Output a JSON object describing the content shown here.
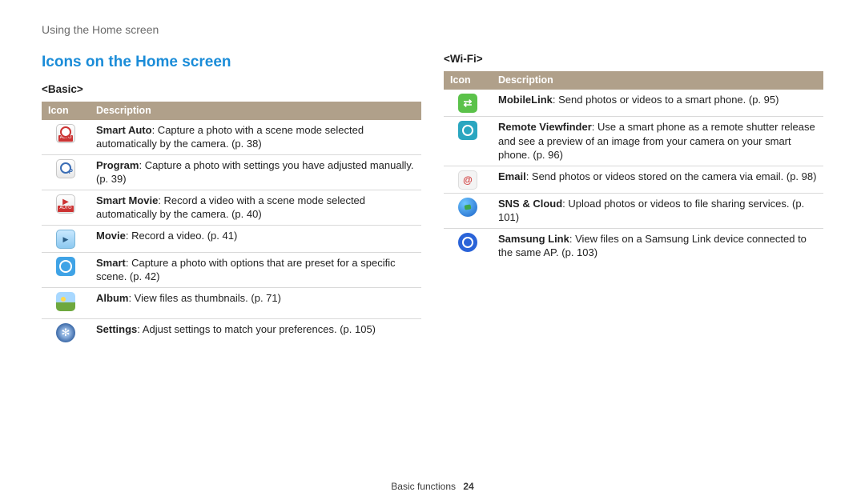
{
  "breadcrumb": "Using the Home screen",
  "section_title": "Icons on the Home screen",
  "headers": {
    "icon": "Icon",
    "desc": "Description"
  },
  "groups": {
    "basic": {
      "label": "<Basic>",
      "rows": [
        {
          "icon": "smart-auto",
          "bold": "Smart Auto",
          "rest": ": Capture a photo with a scene mode selected automatically by the camera. (p. 38)"
        },
        {
          "icon": "program",
          "bold": "Program",
          "rest": ": Capture a photo with settings you have adjusted manually. (p. 39)"
        },
        {
          "icon": "smart-movie",
          "bold": "Smart Movie",
          "rest": ": Record a video with a scene mode selected automatically by the camera. (p. 40)"
        },
        {
          "icon": "movie",
          "bold": "Movie",
          "rest": ": Record a video. (p. 41)"
        },
        {
          "icon": "smart",
          "bold": "Smart",
          "rest": ": Capture a photo with options that are preset for a specific scene. (p. 42)"
        },
        {
          "icon": "album",
          "bold": "Album",
          "rest": ": View files as thumbnails. (p. 71)"
        },
        {
          "icon": "settings",
          "bold": "Settings",
          "rest": ": Adjust settings to match your preferences. (p. 105)"
        }
      ]
    },
    "wifi": {
      "label": "<Wi-Fi>",
      "rows": [
        {
          "icon": "mobilelink",
          "bold": "MobileLink",
          "rest": ": Send photos or videos to a smart phone. (p. 95)"
        },
        {
          "icon": "remote-vf",
          "bold": "Remote Viewfinder",
          "rest": ": Use a smart phone as a remote shutter release and see a preview of an image from your camera on your smart phone. (p. 96)"
        },
        {
          "icon": "email",
          "bold": "Email",
          "rest": ": Send photos or videos stored on the camera via email. (p. 98)"
        },
        {
          "icon": "globe",
          "bold": "SNS & Cloud",
          "rest": ": Upload photos or videos to file sharing services. (p. 101)"
        },
        {
          "icon": "samsung-link",
          "bold": "Samsung Link",
          "rest": ": View files on a Samsung Link device connected to the same AP. (p. 103)"
        }
      ]
    }
  },
  "footer": {
    "section": "Basic functions",
    "page": "24"
  }
}
